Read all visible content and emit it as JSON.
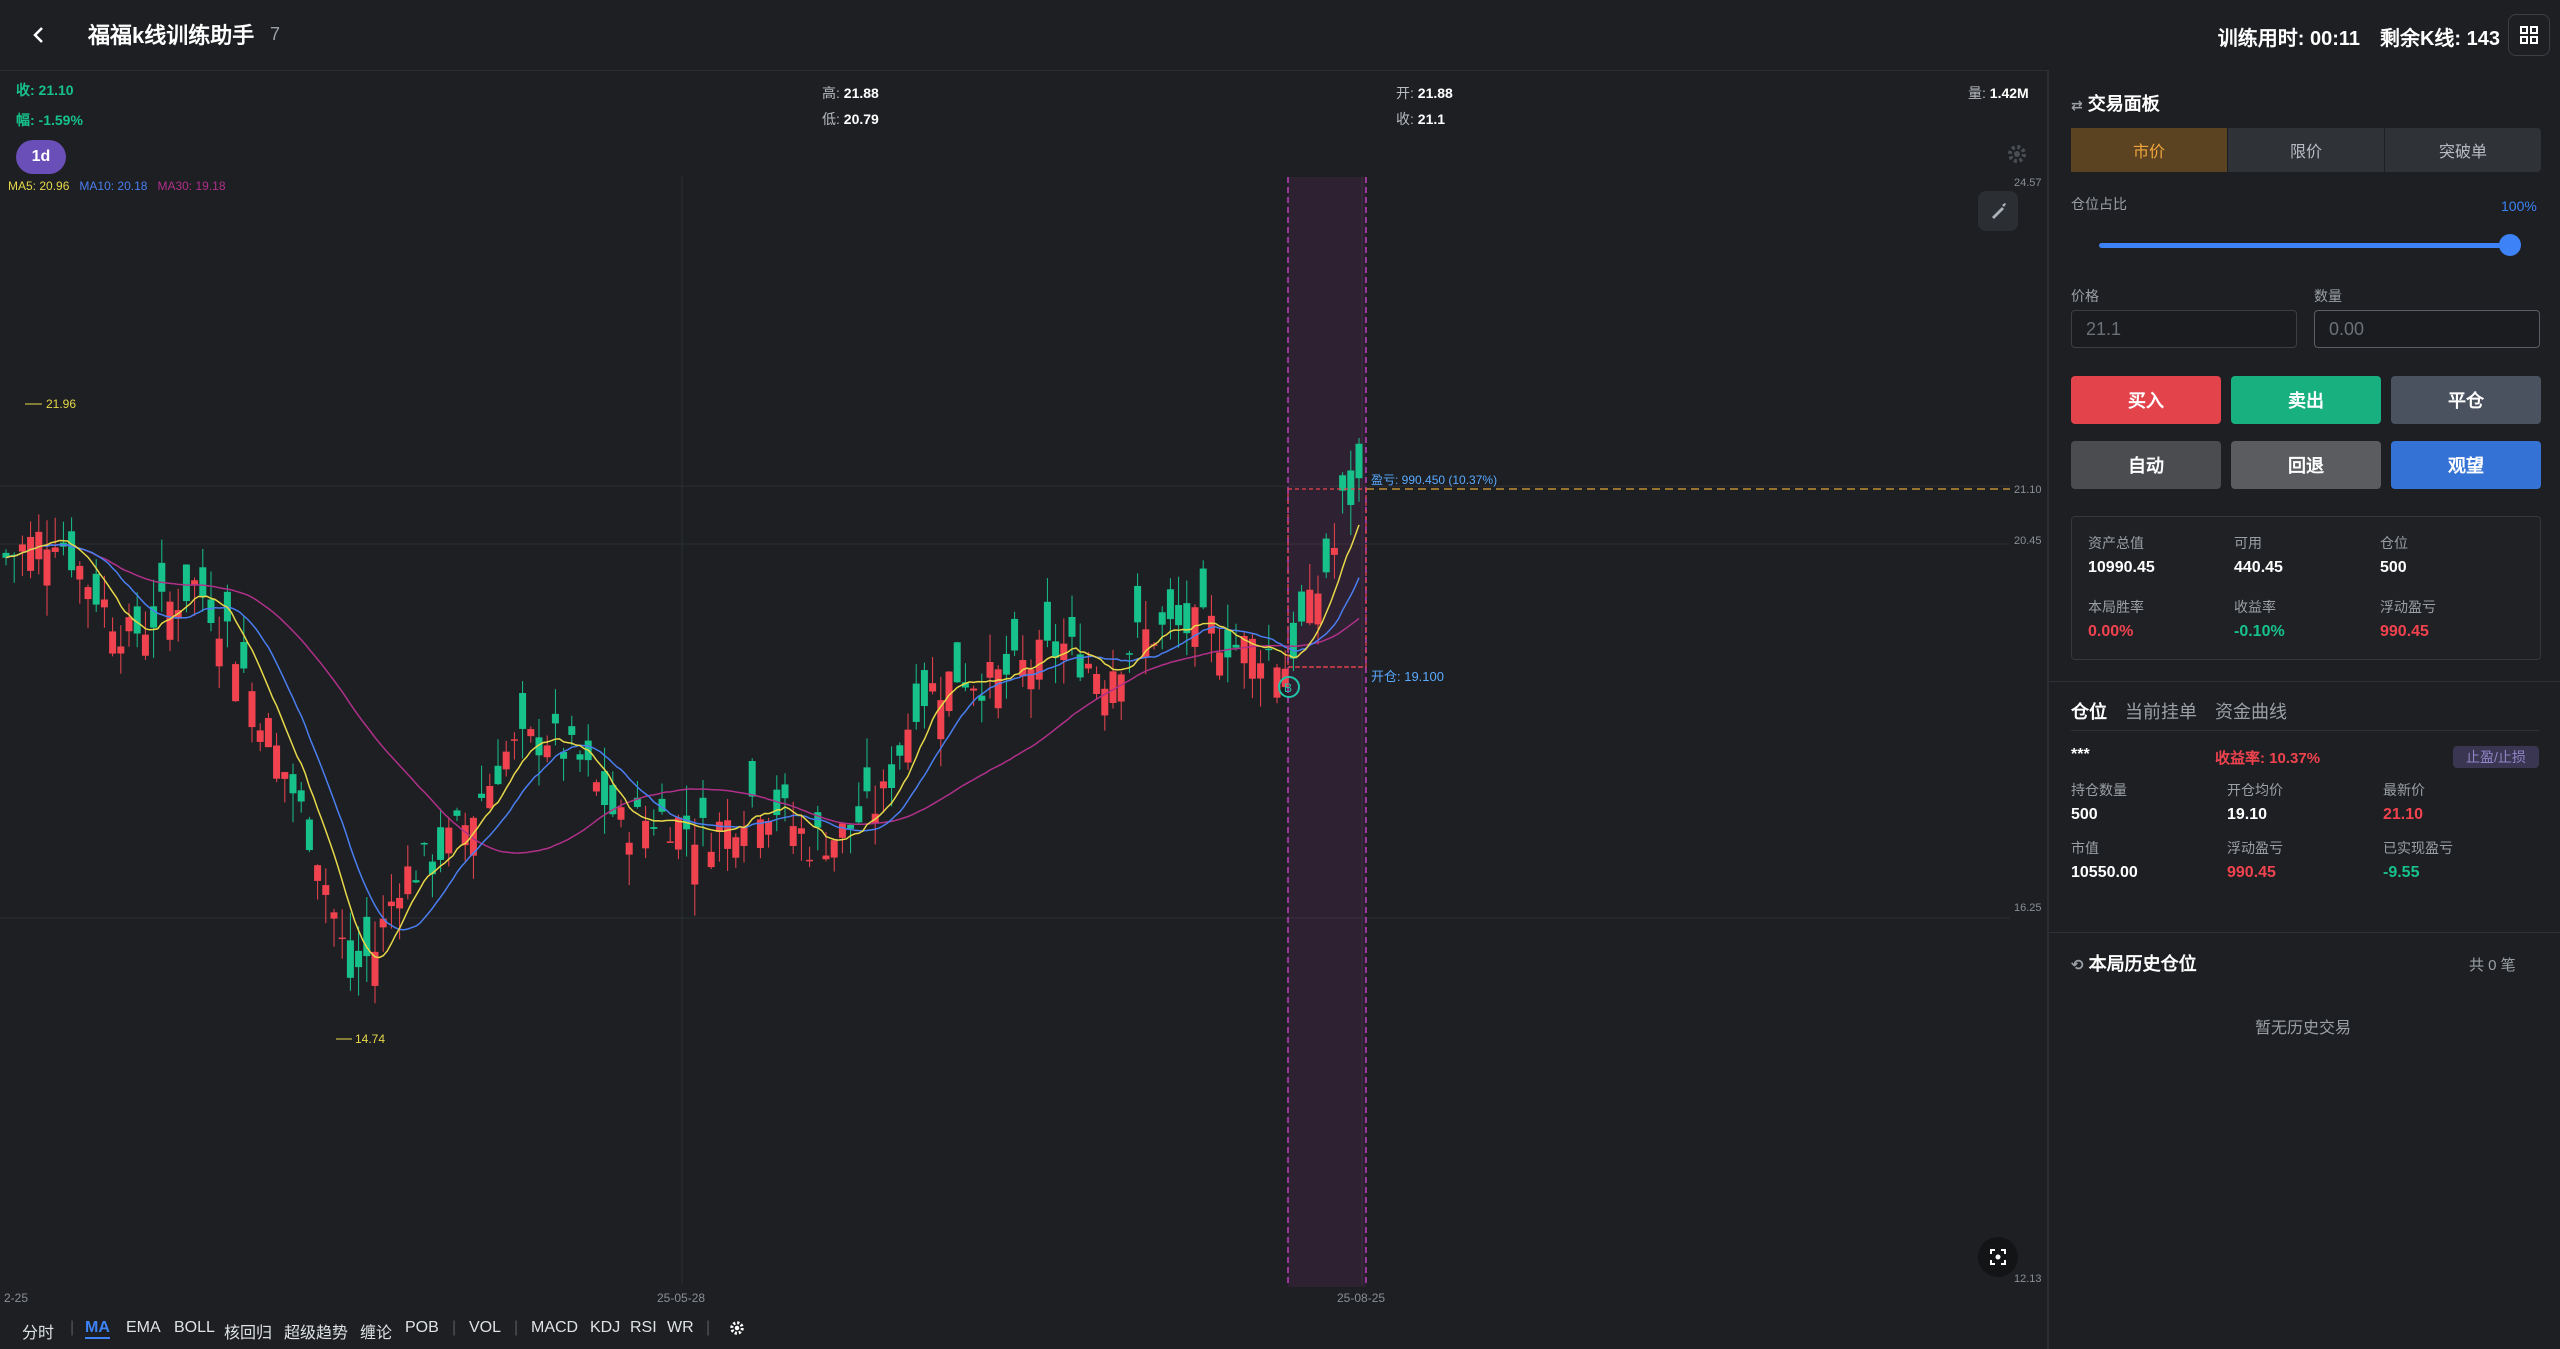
{
  "header": {
    "title": "福福k线训练助手",
    "badge": "7",
    "timer": "训练用时: 00:11",
    "k_left": "剩余K线: 143"
  },
  "ohlc": {
    "close_label": "收: 21.10",
    "change_label": "幅: -1.59%",
    "high_label": "高:",
    "high": "21.88",
    "low_label": "低:",
    "low": "20.79",
    "open_label": "开:",
    "open": "21.88",
    "close2_label": "收:",
    "close2": "21.1",
    "vol_label": "量:",
    "vol": "1.42M"
  },
  "timeframe": "1d",
  "ma_legend": {
    "ma5": "MA5: 20.96",
    "ma10": "MA10: 20.18",
    "ma30": "MA30: 19.18"
  },
  "colors": {
    "up": "#f0434f",
    "down": "#17c28a",
    "ma5": "#e7d84a",
    "ma10": "#4a7ef0",
    "ma30": "#b0308a",
    "accent": "#3d82f6"
  },
  "chart_data": {
    "type": "candlestick",
    "y_ticks": [
      "24.57",
      "21.10",
      "20.45",
      "16.25",
      "12.13"
    ],
    "x_ticks": [
      "2-25",
      "25-05-28",
      "25-08-25"
    ],
    "annotations": {
      "high_mark": "21.96",
      "low_mark": "14.74",
      "pnl": "盈亏: 990.450 (10.37%)",
      "entry": "开仓: 19.100"
    },
    "ylim": [
      12.13,
      24.57
    ]
  },
  "bottom_toolbar": [
    "分时",
    "MA",
    "EMA",
    "BOLL",
    "核回归",
    "超级趋势",
    "缠论",
    "POB",
    "VOL",
    "MACD",
    "KDJ",
    "RSI",
    "WR"
  ],
  "panel": {
    "title": "交易面板",
    "order_types": [
      "市价",
      "限价",
      "突破单"
    ],
    "position_ratio_label": "仓位占比",
    "position_ratio": "100%",
    "price_label": "价格",
    "price_value": "21.1",
    "qty_label": "数量",
    "qty_placeholder": "0.00",
    "buttons": {
      "buy": "买入",
      "sell": "卖出",
      "close": "平仓",
      "auto": "自动",
      "rewind": "回退",
      "watch": "观望"
    },
    "stats": {
      "total_assets_label": "资产总值",
      "total_assets": "10990.45",
      "available_label": "可用",
      "available": "440.45",
      "position_label": "仓位",
      "position": "500",
      "winrate_label": "本局胜率",
      "winrate": "0.00%",
      "return_label": "收益率",
      "return": "-0.10%",
      "float_label": "浮动盈亏",
      "float": "990.45"
    },
    "tabs": [
      "仓位",
      "当前挂单",
      "资金曲线"
    ],
    "position": {
      "name": "***",
      "return_rate": "收益率: 10.37%",
      "sl_tp": "止盈/止损",
      "hold_qty_label": "持仓数量",
      "hold_qty": "500",
      "avg_price_label": "开仓均价",
      "avg_price": "19.10",
      "last_label": "最新价",
      "last": "21.10",
      "mkt_label": "市值",
      "mkt": "10550.00",
      "float_label": "浮动盈亏",
      "float": "990.45",
      "realized_label": "已实现盈亏",
      "realized": "-9.55"
    },
    "history": {
      "title": "本局历史仓位",
      "count": "共 0 笔",
      "empty": "暂无历史交易"
    }
  }
}
